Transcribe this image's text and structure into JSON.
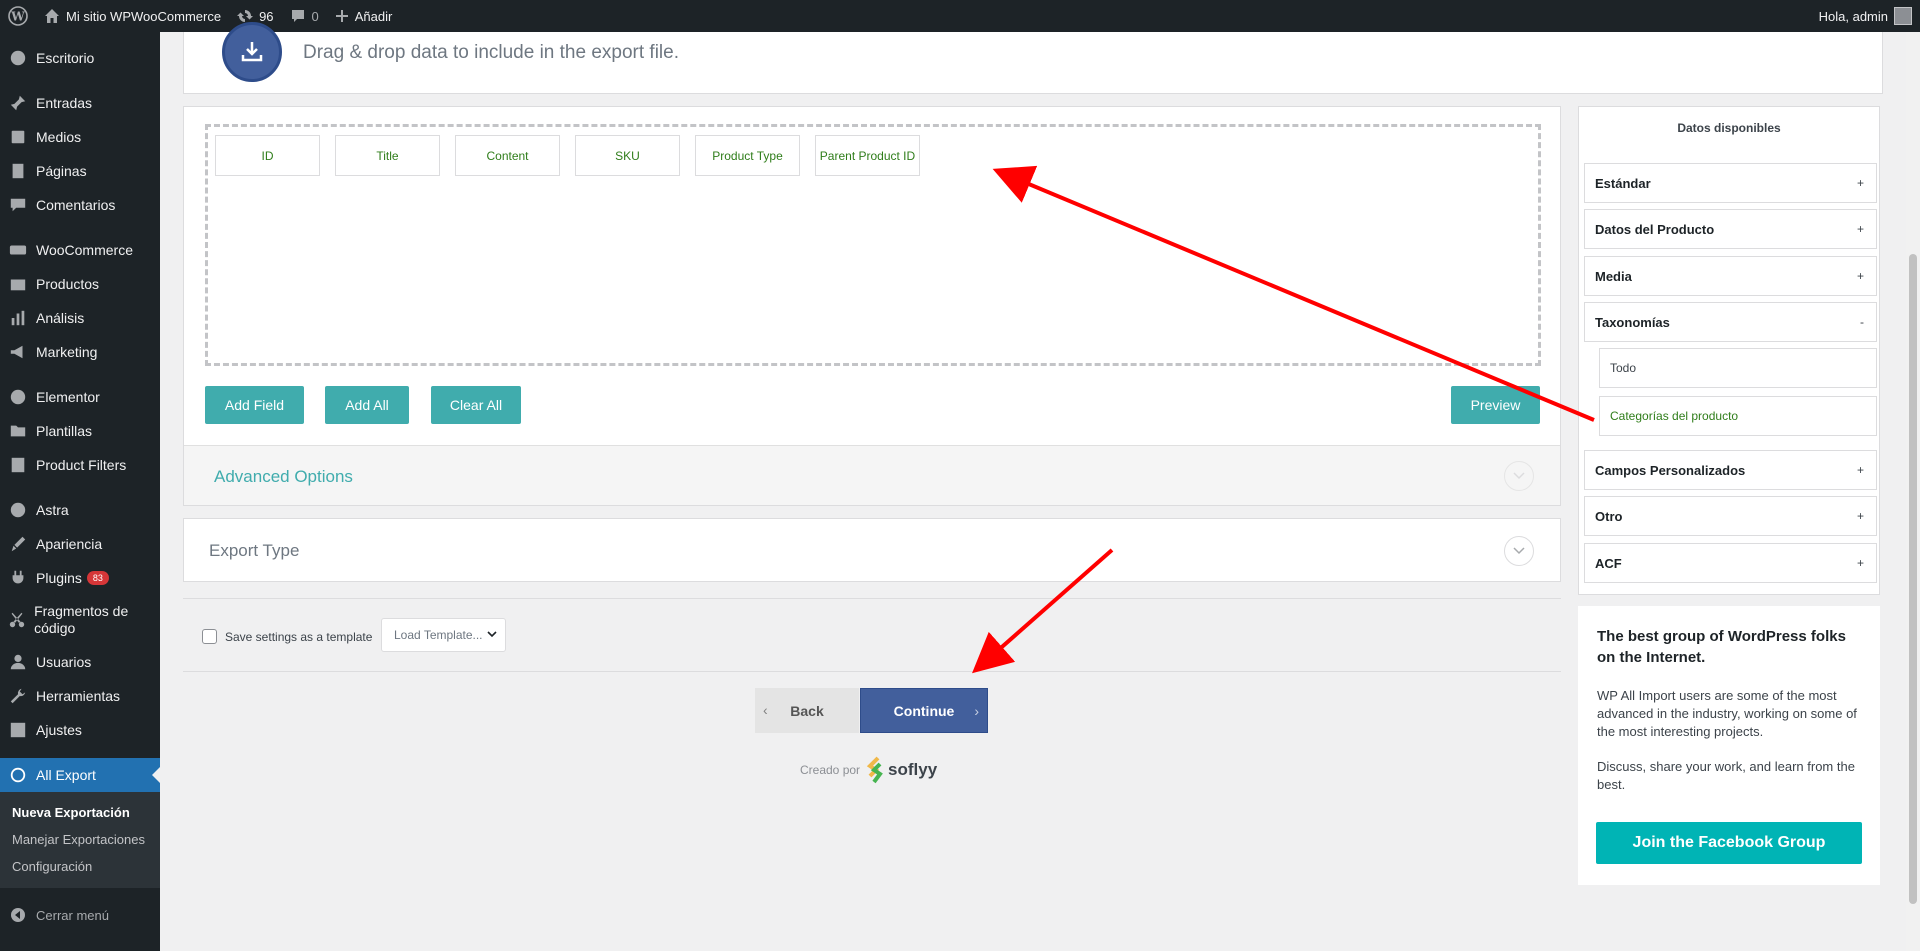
{
  "adminbar": {
    "site_name": "Mi sitio WPWooCommerce",
    "updates_count": "96",
    "comments_count": "0",
    "new_label": "Añadir",
    "greeting": "Hola, admin"
  },
  "sidebar": {
    "items": [
      {
        "label": "Escritorio",
        "icon": "dashboard-icon"
      },
      {
        "label": "Entradas",
        "icon": "pin-icon"
      },
      {
        "label": "Medios",
        "icon": "media-icon"
      },
      {
        "label": "Páginas",
        "icon": "pages-icon"
      },
      {
        "label": "Comentarios",
        "icon": "comments-icon"
      },
      {
        "label": "WooCommerce",
        "icon": "woo-icon"
      },
      {
        "label": "Productos",
        "icon": "products-icon"
      },
      {
        "label": "Análisis",
        "icon": "analytics-icon"
      },
      {
        "label": "Marketing",
        "icon": "megaphone-icon"
      },
      {
        "label": "Elementor",
        "icon": "elementor-icon"
      },
      {
        "label": "Plantillas",
        "icon": "folder-icon"
      },
      {
        "label": "Product Filters",
        "icon": "filter-icon"
      },
      {
        "label": "Astra",
        "icon": "astra-icon"
      },
      {
        "label": "Apariencia",
        "icon": "brush-icon"
      },
      {
        "label": "Plugins",
        "icon": "plugin-icon",
        "badge": "83"
      },
      {
        "label": "Fragmentos de código",
        "icon": "scissors-icon"
      },
      {
        "label": "Usuarios",
        "icon": "users-icon"
      },
      {
        "label": "Herramientas",
        "icon": "wrench-icon"
      },
      {
        "label": "Ajustes",
        "icon": "settings-icon"
      },
      {
        "label": "All Export",
        "icon": "export-icon"
      }
    ],
    "submenu": [
      "Nueva Exportación",
      "Manejar Exportaciones",
      "Configuración"
    ],
    "collapse_label": "Cerrar menú"
  },
  "export": {
    "drag_text": "Drag & drop data to include in the export file.",
    "fields": [
      "ID",
      "Title",
      "Content",
      "SKU",
      "Product Type",
      "Parent Product ID"
    ],
    "add_field": "Add Field",
    "add_all": "Add All",
    "clear_all": "Clear All",
    "preview": "Preview",
    "advanced_options": "Advanced Options",
    "export_type": "Export Type",
    "save_template_label": "Save settings as a template",
    "load_template": "Load Template...",
    "back": "Back",
    "continue": "Continue",
    "created_by": "Creado por",
    "brand": "soflyy"
  },
  "datos": {
    "title": "Datos disponibles",
    "categories": [
      {
        "label": "Estándar",
        "toggle": "+"
      },
      {
        "label": "Datos del Producto",
        "toggle": "+"
      },
      {
        "label": "Media",
        "toggle": "+"
      },
      {
        "label": "Taxonomías",
        "toggle": "-"
      },
      {
        "label": "Campos Personalizados",
        "toggle": "+"
      },
      {
        "label": "Otro",
        "toggle": "+"
      },
      {
        "label": "ACF",
        "toggle": "+"
      }
    ],
    "taxonomy_items": [
      "Todo",
      "Categorías del producto"
    ]
  },
  "promo": {
    "heading": "The best group of WordPress folks on the Internet.",
    "para1": "WP All Import users are some of the most advanced in the industry, working on some of the most interesting projects.",
    "para2": "Discuss, share your work, and learn from the best.",
    "button": "Join the Facebook Group"
  },
  "colors": {
    "accent": "#40acad",
    "primary": "#425f9c",
    "field_text": "#2f7d1a",
    "annotation": "#ff0000"
  }
}
